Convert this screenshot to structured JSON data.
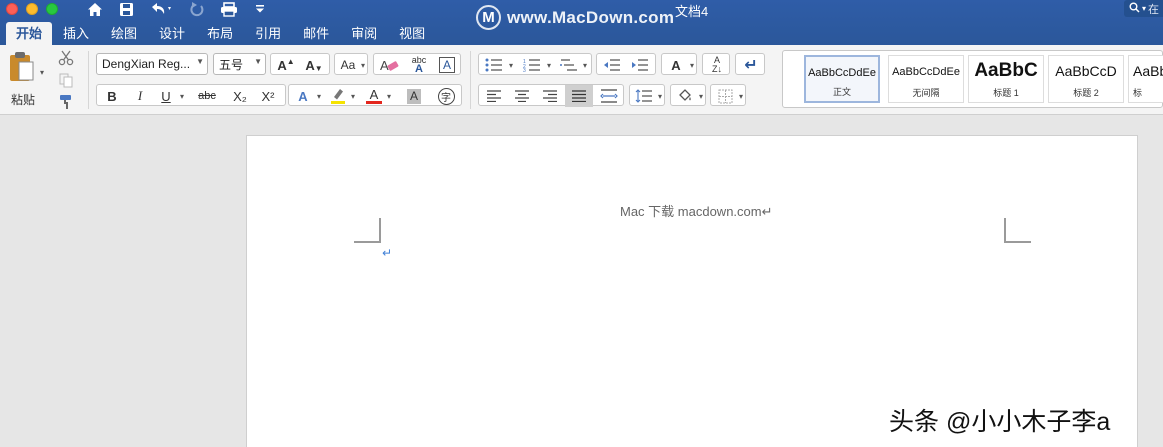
{
  "window": {
    "title": "文档4"
  },
  "watermark": {
    "logo": "M",
    "text": "www.MacDown.com"
  },
  "search": {
    "icon": "search-icon",
    "label": "在"
  },
  "quick_access": {
    "icons": [
      "home-icon",
      "save-icon",
      "undo-icon",
      "redo-icon",
      "print-icon",
      "customize-icon"
    ]
  },
  "tabs": [
    "开始",
    "插入",
    "绘图",
    "设计",
    "布局",
    "引用",
    "邮件",
    "审阅",
    "视图"
  ],
  "ribbon": {
    "paste_label": "粘贴",
    "font_name": "DengXian Reg...",
    "font_size": "五号",
    "bold": "B",
    "italic": "I",
    "underline": "U",
    "strikethrough": "abc",
    "subscript": "X₂",
    "superscript": "X²",
    "phonetic": "abc",
    "enclose": "字",
    "styles": [
      {
        "sample": "AaBbCcDdEe",
        "name": "正文"
      },
      {
        "sample": "AaBbCcDdEe",
        "name": "无间隔"
      },
      {
        "sample": "AaBbC",
        "name": "标题 1"
      },
      {
        "sample": "AaBbCcD",
        "name": "标题 2"
      },
      {
        "sample": "AaBb",
        "name": "标"
      }
    ],
    "colors": {
      "highlight": "#f5e300",
      "font_color": "#e3261d",
      "accent": "#2b579a"
    }
  },
  "document": {
    "header_text": "Mac 下载 macdown.com↵",
    "paragraph_mark": "↵"
  },
  "credit": "头条 @小小木子李a"
}
